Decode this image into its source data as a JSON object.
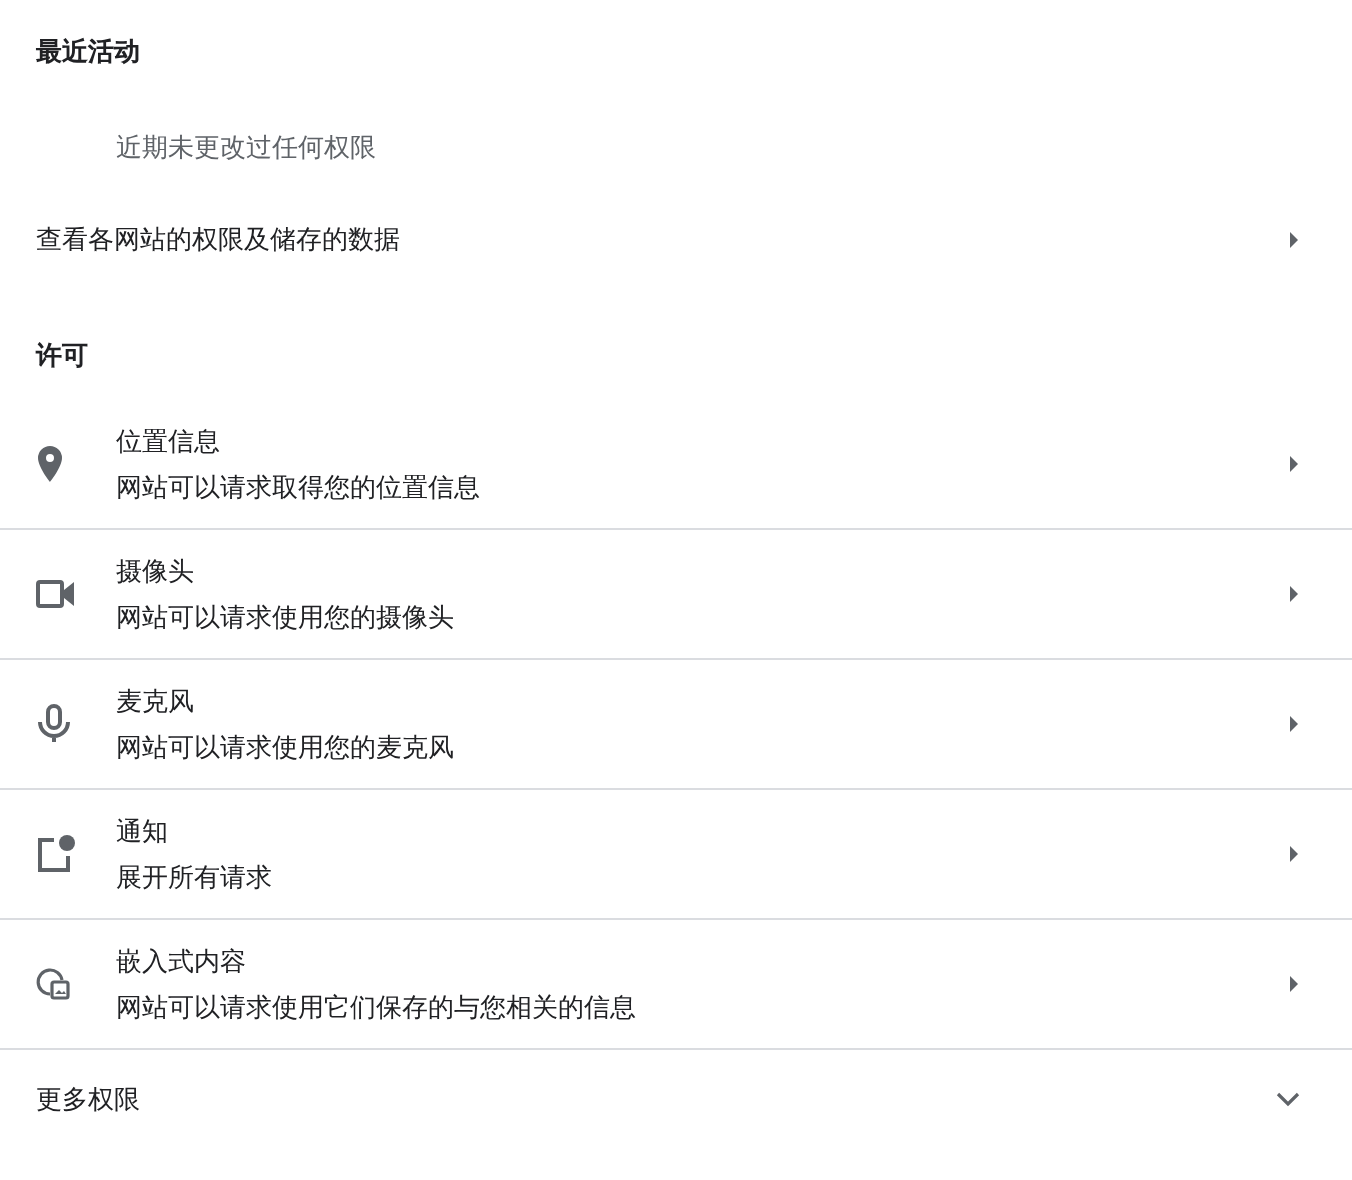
{
  "recent": {
    "title": "最近活动",
    "empty": "近期未更改过任何权限",
    "link": "查看各网站的权限及储存的数据"
  },
  "permissions": {
    "title": "许可",
    "items": [
      {
        "kind": "location",
        "label": "位置信息",
        "description": "网站可以请求取得您的位置信息"
      },
      {
        "kind": "camera",
        "label": "摄像头",
        "description": "网站可以请求使用您的摄像头"
      },
      {
        "kind": "microphone",
        "label": "麦克风",
        "description": "网站可以请求使用您的麦克风"
      },
      {
        "kind": "notifications",
        "label": "通知",
        "description": "展开所有请求"
      },
      {
        "kind": "embedded",
        "label": "嵌入式内容",
        "description": "网站可以请求使用它们保存的与您相关的信息"
      }
    ]
  },
  "more": {
    "label": "更多权限",
    "expanded": false
  }
}
